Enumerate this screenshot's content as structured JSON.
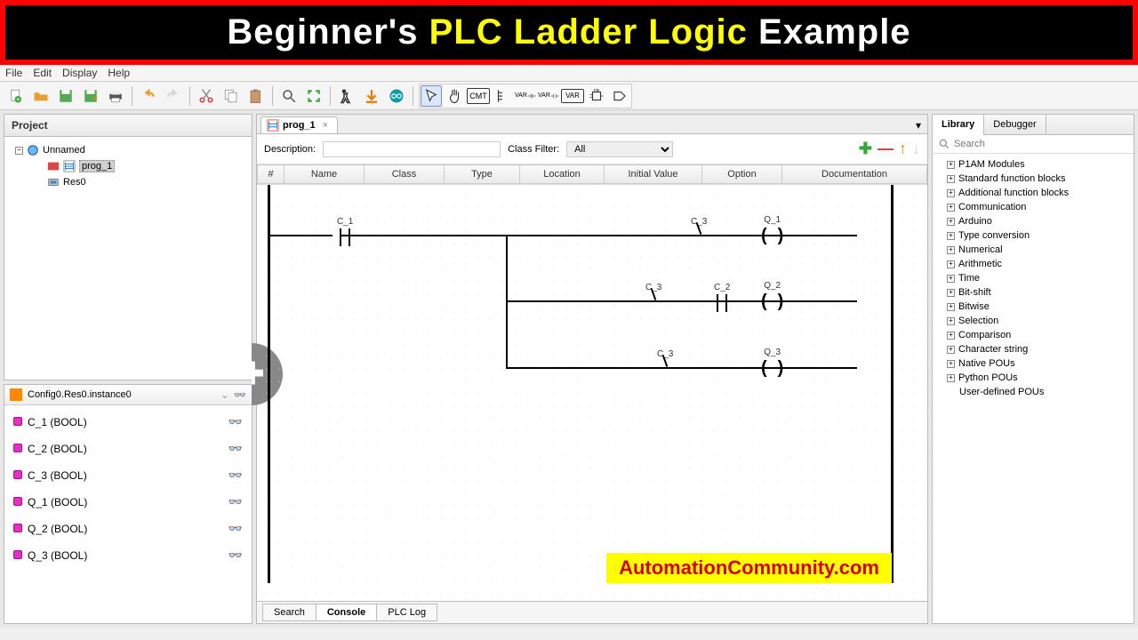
{
  "banner": {
    "part1": "Beginner's ",
    "highlight": "PLC Ladder Logic",
    "part2": " Example"
  },
  "menubar": [
    "File",
    "Edit",
    "Display",
    "Help"
  ],
  "project": {
    "title": "Project",
    "root": "Unnamed",
    "prog": "prog_1",
    "res": "Res0"
  },
  "instances": {
    "path": "Config0.Res0.instance0",
    "vars": [
      "C_1 (BOOL)",
      "C_2 (BOOL)",
      "C_3 (BOOL)",
      "Q_1 (BOOL)",
      "Q_2 (BOOL)",
      "Q_3 (BOOL)"
    ]
  },
  "editor": {
    "tab": "prog_1",
    "desc_label": "Description:",
    "filter_label": "Class Filter:",
    "filter_value": "All",
    "columns": [
      "#",
      "Name",
      "Class",
      "Type",
      "Location",
      "Initial Value",
      "Option",
      "Documentation"
    ]
  },
  "ladder": {
    "c1": "C_1",
    "c2": "C_2",
    "c3": "C_3",
    "q1": "Q_1",
    "q2": "Q_2",
    "q3": "Q_3"
  },
  "watermark": "AutomationCommunity.com",
  "bottom_tabs": [
    "Search",
    "Console",
    "PLC Log"
  ],
  "right": {
    "tabs": [
      "Library",
      "Debugger"
    ],
    "search_placeholder": "Search",
    "items": [
      "P1AM Modules",
      "Standard function blocks",
      "Additional function blocks",
      "Communication",
      "Arduino",
      "Type conversion",
      "Numerical",
      "Arithmetic",
      "Time",
      "Bit-shift",
      "Bitwise",
      "Selection",
      "Comparison",
      "Character string",
      "Native POUs",
      "Python POUs"
    ],
    "leaf": "User-defined POUs"
  }
}
